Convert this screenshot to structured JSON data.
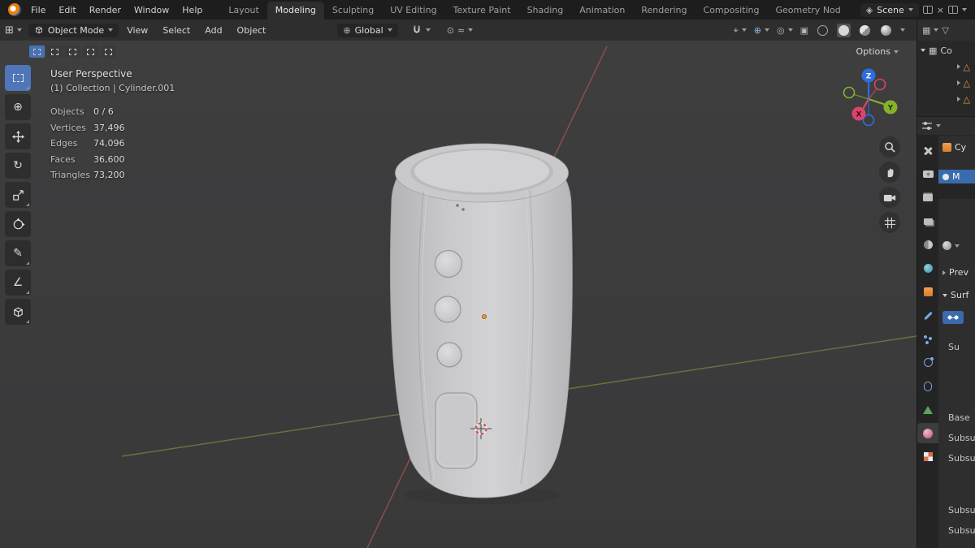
{
  "topbar": {
    "menus": [
      "File",
      "Edit",
      "Render",
      "Window",
      "Help"
    ],
    "tabs": [
      "Layout",
      "Modeling",
      "Sculpting",
      "UV Editing",
      "Texture Paint",
      "Shading",
      "Animation",
      "Rendering",
      "Compositing",
      "Geometry Nod"
    ],
    "active_tab": "Modeling",
    "scene_name": "Scene"
  },
  "header": {
    "mode": "Object Mode",
    "menus": [
      "View",
      "Select",
      "Add",
      "Object"
    ],
    "orientation": "Global"
  },
  "viewport": {
    "view_label": "User Perspective",
    "context_label": "(1) Collection | Cylinder.001",
    "stats": {
      "rows": [
        {
          "label": "Objects",
          "value": "0 / 6"
        },
        {
          "label": "Vertices",
          "value": "37,496"
        },
        {
          "label": "Edges",
          "value": "74,096"
        },
        {
          "label": "Faces",
          "value": "36,600"
        },
        {
          "label": "Triangles",
          "value": "73,200"
        }
      ]
    },
    "options_label": "Options",
    "axis_labels": {
      "x": "X",
      "y": "Y",
      "z": "Z"
    }
  },
  "outliner": {
    "collection_label": "Co"
  },
  "properties": {
    "breadcrumb": "Cy",
    "material_slot_label": "M",
    "preview_panel": "Prev",
    "surface_panel": "Surf",
    "surface_field": "Su",
    "base_color_label": "Base",
    "subsurface_labels": [
      "Subsu",
      "Subsu",
      "Subsu",
      "Subsu"
    ]
  },
  "icons": {
    "editor_type": "⊞",
    "orientation": "⊕",
    "cursor_tool": "⊕",
    "rotate_tool": "↻",
    "annotate_tool": "✎",
    "measure_tool": "∠",
    "prop_edit_center": "⊙",
    "prop_edit_falloff": "≈",
    "selectability": "⌖",
    "gizmo_toggle": "⊕",
    "overlays": "◎",
    "xray": "▣",
    "collection": "▦",
    "mesh_triangle": "△",
    "filter": "▽",
    "scene_diamond": "◈",
    "close": "×"
  },
  "colors": {
    "accent_blue": "#4772b3",
    "object_orange": "#e8923c",
    "axis_x_red": "#a05252",
    "axis_y_green": "#75803f",
    "model_gray": "#c9c9cb"
  }
}
